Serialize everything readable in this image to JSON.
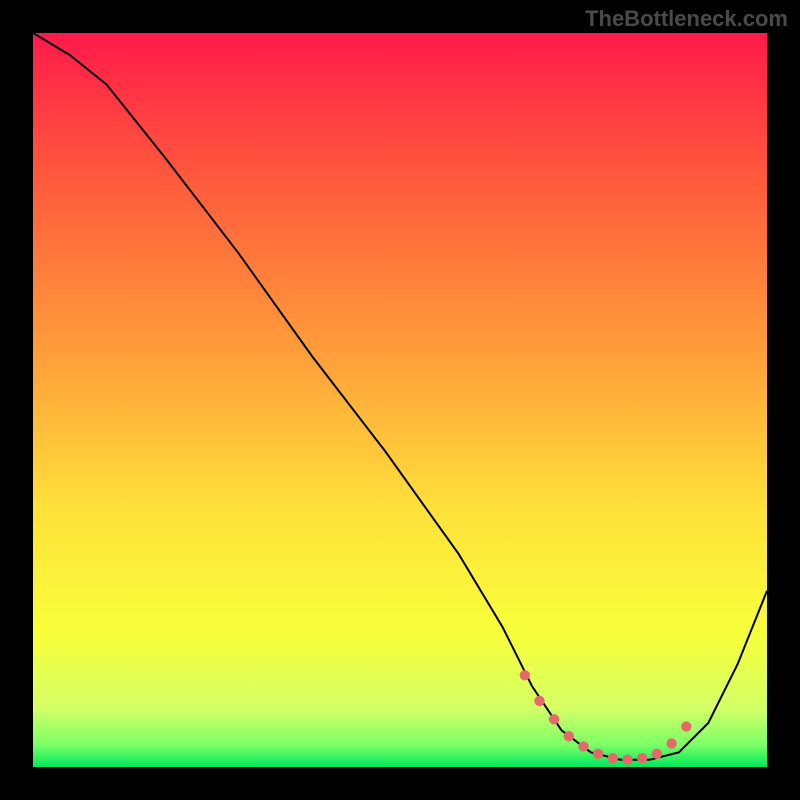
{
  "watermark": "TheBottleneck.com",
  "chart_data": {
    "type": "line",
    "title": "",
    "xlabel": "",
    "ylabel": "",
    "xlim": [
      0,
      100
    ],
    "ylim": [
      0,
      100
    ],
    "gradient_stops": [
      {
        "offset": 0,
        "color": "#ff1a4a"
      },
      {
        "offset": 20,
        "color": "#ff5a3c"
      },
      {
        "offset": 45,
        "color": "#ffa23a"
      },
      {
        "offset": 65,
        "color": "#ffe13a"
      },
      {
        "offset": 82,
        "color": "#f7ff3a"
      },
      {
        "offset": 92,
        "color": "#d4ff66"
      },
      {
        "offset": 97,
        "color": "#7cff66"
      },
      {
        "offset": 100,
        "color": "#00e85c"
      }
    ],
    "series": [
      {
        "name": "curve",
        "type": "line",
        "color": "#000000",
        "width": 2,
        "x": [
          0,
          5,
          10,
          18,
          28,
          38,
          48,
          58,
          64,
          68,
          72,
          76,
          80,
          84,
          88,
          92,
          96,
          100
        ],
        "y": [
          100,
          97,
          93,
          83,
          70,
          56,
          43,
          29,
          19,
          11,
          5,
          2,
          1,
          1,
          2,
          6,
          14,
          24
        ]
      },
      {
        "name": "valley-markers",
        "type": "scatter",
        "color": "#e46a6a",
        "radius": 5.2,
        "x": [
          67,
          69,
          71,
          73,
          75,
          77,
          79,
          81,
          83,
          85,
          87,
          89
        ],
        "y": [
          12.5,
          9,
          6.5,
          4.2,
          2.8,
          1.8,
          1.2,
          1.0,
          1.2,
          1.8,
          3.2,
          5.5
        ]
      }
    ]
  }
}
